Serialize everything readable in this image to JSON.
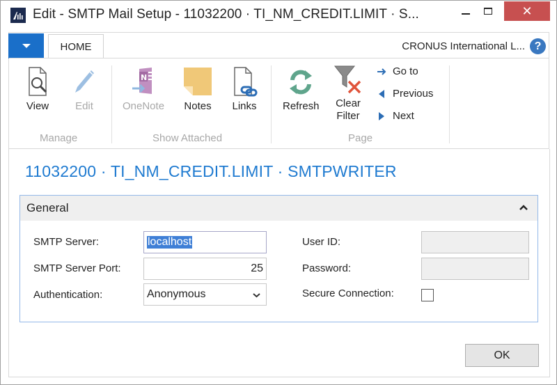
{
  "window": {
    "title": "Edit - SMTP Mail Setup - 11032200 · TI_NM_CREDIT.LIMIT · S...",
    "minimize_icon": "minimize-icon",
    "maximize_icon": "maximize-icon",
    "close_glyph": "✕"
  },
  "ribbon": {
    "app_menu_icon": "dropdown-triangle-icon",
    "tabs": [
      {
        "label": "HOME",
        "active": true
      }
    ],
    "company": "CRONUS International L...",
    "help_glyph": "?",
    "groups": [
      {
        "label": "Manage",
        "buttons": [
          {
            "label": "View",
            "icon": "view-document-icon",
            "enabled": true
          },
          {
            "label": "Edit",
            "icon": "pencil-icon",
            "enabled": false
          }
        ]
      },
      {
        "label": "Show Attached",
        "buttons": [
          {
            "label": "OneNote",
            "icon": "onenote-icon",
            "enabled": false
          },
          {
            "label": "Notes",
            "icon": "note-icon",
            "enabled": true
          },
          {
            "label": "Links",
            "icon": "link-document-icon",
            "enabled": true
          }
        ]
      },
      {
        "label": "Page",
        "buttons": [
          {
            "label": "Refresh",
            "icon": "refresh-icon",
            "enabled": true
          },
          {
            "label": "Clear Filter",
            "label_line1": "Clear",
            "label_line2": "Filter",
            "icon": "clear-filter-icon",
            "enabled": true
          }
        ],
        "nav_items": [
          {
            "label": "Go to",
            "icon": "arrow-right-icon"
          },
          {
            "label": "Previous",
            "icon": "triangle-left-icon"
          },
          {
            "label": "Next",
            "icon": "triangle-right-icon"
          }
        ]
      }
    ]
  },
  "page": {
    "title": "11032200 · TI_NM_CREDIT.LIMIT · SMTPWRITER"
  },
  "general": {
    "title": "General",
    "collapse_icon": "chevron-up-icon",
    "fields": {
      "smtp_server": {
        "label": "SMTP Server:",
        "value": "localhost",
        "selected": true
      },
      "smtp_port": {
        "label": "SMTP Server Port:",
        "value": "25"
      },
      "authentication": {
        "label": "Authentication:",
        "value": "Anonymous"
      },
      "user_id": {
        "label": "User ID:",
        "value": "",
        "disabled": true
      },
      "password": {
        "label": "Password:",
        "value": "",
        "disabled": true
      },
      "secure_connection": {
        "label": "Secure Connection:",
        "checked": false
      }
    }
  },
  "footer": {
    "ok_label": "OK"
  },
  "colors": {
    "accent": "#1a6fc9",
    "title_blue": "#1e7ad0",
    "close_red": "#c75050",
    "fasttab_border": "#93b8e8",
    "selection": "#3f7fd6",
    "disabled_text": "#a8a8a8"
  }
}
